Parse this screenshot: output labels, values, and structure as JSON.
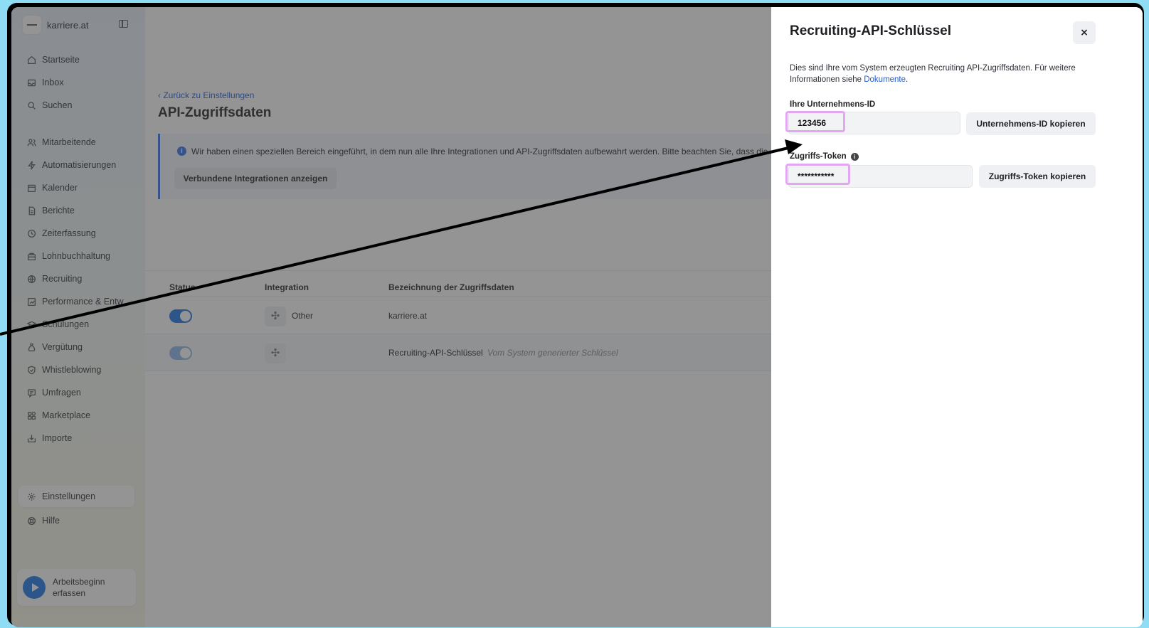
{
  "app": {
    "brand": "karriere.at"
  },
  "sidebar": {
    "items": [
      {
        "label": "Startseite",
        "icon": "home-icon"
      },
      {
        "label": "Inbox",
        "icon": "inbox-icon"
      },
      {
        "label": "Suchen",
        "icon": "search-icon"
      },
      {
        "label": "Mitarbeitende",
        "icon": "users-icon"
      },
      {
        "label": "Automatisierungen",
        "icon": "lightning-icon"
      },
      {
        "label": "Kalender",
        "icon": "calendar-icon"
      },
      {
        "label": "Berichte",
        "icon": "report-icon"
      },
      {
        "label": "Zeiterfassung",
        "icon": "clock-icon"
      },
      {
        "label": "Lohnbuchhaltung",
        "icon": "payroll-icon"
      },
      {
        "label": "Recruiting",
        "icon": "globe-icon"
      },
      {
        "label": "Performance & Entw...",
        "icon": "performance-icon"
      },
      {
        "label": "Schulungen",
        "icon": "graduation-icon"
      },
      {
        "label": "Vergütung",
        "icon": "money-bag-icon"
      },
      {
        "label": "Whistleblowing",
        "icon": "shield-icon"
      },
      {
        "label": "Umfragen",
        "icon": "survey-icon"
      },
      {
        "label": "Marketplace",
        "icon": "grid-icon"
      },
      {
        "label": "Importe",
        "icon": "import-icon"
      },
      {
        "label": "Einstellungen",
        "icon": "gear-icon"
      },
      {
        "label": "Hilfe",
        "icon": "help-icon"
      }
    ],
    "clock_in_label": "Arbeitsbeginn erfassen"
  },
  "main": {
    "back_link": "‹ Zurück zu Einstellungen",
    "title": "API-Zugriffsdaten",
    "info_text": "Wir haben einen speziellen Bereich eingeführt, in dem nun alle Ihre Integrationen und API-Zugriffsdaten aufbewahrt werden. Bitte beachten Sie, dass die aktuel",
    "info_button": "Verbundene Integrationen anzeigen",
    "table": {
      "headers": [
        "Status",
        "Integration",
        "Bezeichnung der Zugriffsdaten"
      ],
      "rows": [
        {
          "integration": "Other",
          "name": "karriere.at",
          "note": ""
        },
        {
          "integration": "",
          "name": "Recruiting-API-Schlüssel",
          "note": "Vom System generierter Schlüssel"
        }
      ]
    }
  },
  "panel": {
    "title": "Recruiting-API-Schlüssel",
    "close": "×",
    "description": "Dies sind Ihre vom System erzeugten Recruiting API-Zugriffsdaten. Für weitere Informationen siehe",
    "doc_link": "Dokumente",
    "company_id_label": "Ihre Unternehmens-ID",
    "company_id_value": "123456",
    "company_id_copy": "Unternehmens-ID kopieren",
    "token_label": "Zugriffs-Token",
    "token_value": "***********",
    "token_copy": "Zugriffs-Token kopieren"
  },
  "colors": {
    "accent": "#1a73e8",
    "highlight": "#e2a6f2"
  }
}
